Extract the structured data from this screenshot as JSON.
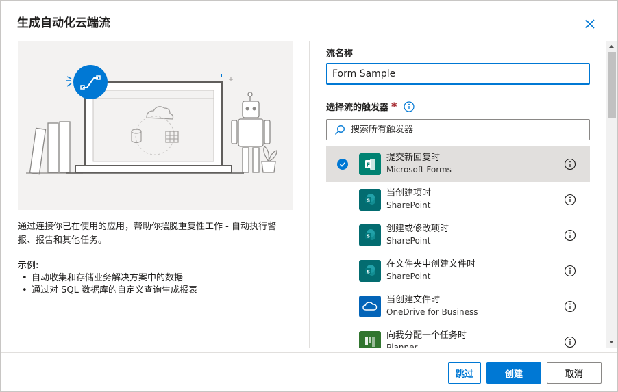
{
  "dialog": {
    "title": "生成自动化云端流",
    "close_icon": "close-icon"
  },
  "left": {
    "description": "通过连接你已在使用的应用，帮助你摆脱重复性工作 - 自动执行警报、报告和其他任务。",
    "examples_title": "示例:",
    "examples": [
      "自动收集和存储业务解决方案中的数据",
      "通过对 SQL 数据库的自定义查询生成报表"
    ]
  },
  "form": {
    "name_label": "流名称",
    "name_value": "Form Sample",
    "trigger_label": "选择流的触发器",
    "required_mark": "*",
    "search_placeholder": "搜索所有触发器"
  },
  "triggers": [
    {
      "name": "提交新回复时",
      "connector": "Microsoft Forms",
      "icon": "forms-icon",
      "color": "#008272",
      "selected": true
    },
    {
      "name": "当创建项时",
      "connector": "SharePoint",
      "icon": "sharepoint-icon",
      "color": "#036C70",
      "selected": false
    },
    {
      "name": "创建或修改项时",
      "connector": "SharePoint",
      "icon": "sharepoint-icon",
      "color": "#036C70",
      "selected": false
    },
    {
      "name": "在文件夹中创建文件时",
      "connector": "SharePoint",
      "icon": "sharepoint-icon",
      "color": "#036C70",
      "selected": false
    },
    {
      "name": "当创建文件时",
      "connector": "OneDrive for Business",
      "icon": "onedrive-icon",
      "color": "#0364B8",
      "selected": false
    },
    {
      "name": "向我分配一个任务时",
      "connector": "Planner",
      "icon": "planner-icon",
      "color": "#31752F",
      "selected": false
    }
  ],
  "buttons": {
    "skip": "跳过",
    "create": "创建",
    "cancel": "取消"
  },
  "colors": {
    "accent": "#0078d4",
    "required": "#a4262c",
    "selected_row": "#e1dfdd"
  }
}
